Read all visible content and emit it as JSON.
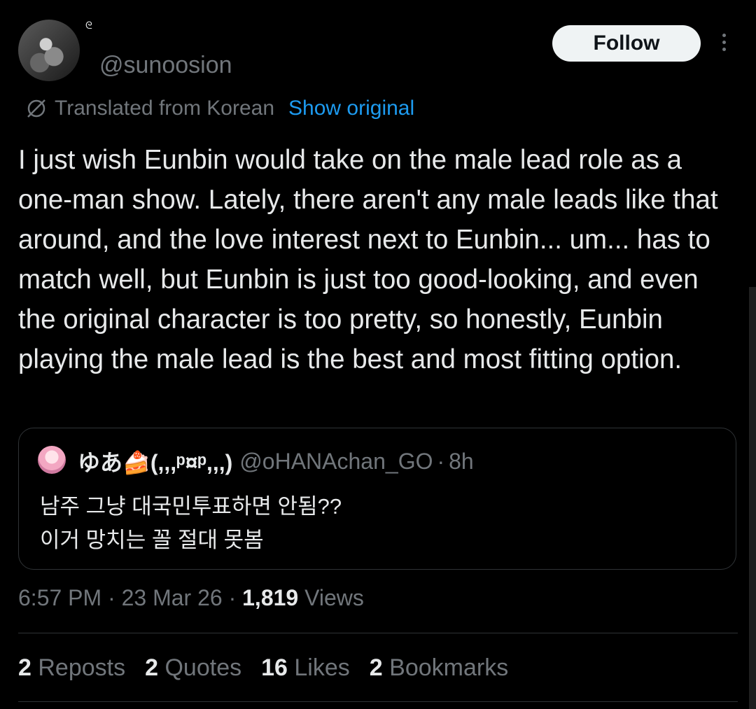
{
  "author": {
    "name_glyph": "ᘓ",
    "handle": "@sunoosion"
  },
  "follow_label": "Follow",
  "translation": {
    "label": "Translated from Korean",
    "link": "Show original"
  },
  "tweet_text": "I just wish Eunbin would take on the male lead role as a one-man show. Lately, there aren't any male leads like that around, and the love interest next to Eunbin... um... has to match well, but Eunbin is just too good-looking, and even the original character is too pretty, so honestly, Eunbin playing the male lead is the best and most fitting option.",
  "quote": {
    "display_name": "ゆあ🍰(,,,ᵖ¤ᵖ,,,)",
    "handle": "@oHANAchan_GO",
    "time": "8h",
    "lines": [
      "남주 그냥 대국민투표하면 안됨??",
      "이거 망치는 꼴 절대 못봄"
    ]
  },
  "meta": {
    "time": "6:57 PM",
    "date": "23 Mar 26",
    "views_count": "1,819",
    "views_label": "Views"
  },
  "stats": [
    {
      "count": "2",
      "label": "Reposts"
    },
    {
      "count": "2",
      "label": "Quotes"
    },
    {
      "count": "16",
      "label": "Likes"
    },
    {
      "count": "2",
      "label": "Bookmarks"
    }
  ],
  "icons": {
    "translate": "translate-icon",
    "more": "more-options-icon"
  }
}
